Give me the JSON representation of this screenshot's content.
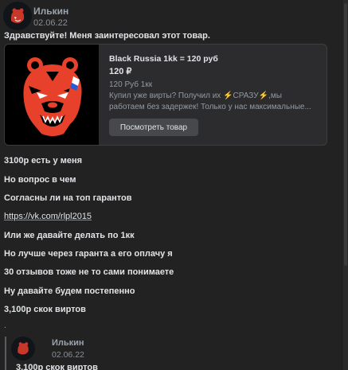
{
  "message": {
    "author": "Илькин",
    "date": "02.06.22",
    "greeting": "Здравствуйте! Меня заинтересовал этот товар."
  },
  "product_card": {
    "title": "Black Russia 1kk = 120 руб",
    "price": "120 ₽",
    "subtitle": "120 Руб 1кк",
    "desc_line1_a": "Купил уже вирты? Получил их ",
    "desc_line1_b": "СРАЗУ",
    "desc_line1_c": ",мы",
    "desc_line2": "работаем без задержек! Только у нас максимальные...",
    "button_label": "Посмотреть товар",
    "image_icon": "bear-logo-icon",
    "accent_color": "#e8412b"
  },
  "lines": [
    "3100р есть у меня",
    "Но вопрос в чем",
    "Согласны ли на топ гарантов",
    "https://vk.com/rlpl2015",
    "Или же давайте делать по 1кк",
    "Но лучше через гаранта а его оплачу я",
    "30 отзывов тоже не то сами понимаете",
    "Ну давайте будем постепенно",
    "3,100р скок виртов"
  ],
  "separator": ".",
  "quoted": {
    "author": "Илькин",
    "date": "02.06.22",
    "text": "3,100р скок виртов"
  }
}
